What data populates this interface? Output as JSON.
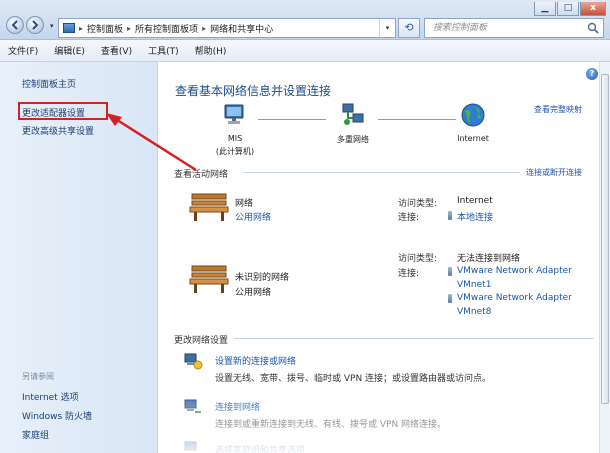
{
  "window": {
    "minimize": "▁",
    "maximize": "□",
    "close": "x"
  },
  "nav": {
    "back_icon": "back-arrow-icon",
    "forward_icon": "forward-arrow-icon",
    "history_icon": "chevron-down-icon"
  },
  "breadcrumb": [
    "控制面板",
    "所有控制面板项",
    "网络和共享中心"
  ],
  "search": {
    "placeholder": "搜索控制面板"
  },
  "menu": [
    "文件(F)",
    "编辑(E)",
    "查看(V)",
    "工具(T)",
    "帮助(H)"
  ],
  "sidebar": {
    "home": "控制面板主页",
    "items": [
      "更改适配器设置",
      "更改高级共享设置"
    ],
    "see_also_title": "另请参阅",
    "see_also": [
      "Internet 选项",
      "Windows 防火墙",
      "家庭组"
    ]
  },
  "main": {
    "title": "查看基本网络信息并设置连接",
    "view_full_map": "查看完整映射",
    "map_nodes": [
      {
        "label": "MIS",
        "sub": "(此计算机)",
        "icon": "computer-icon"
      },
      {
        "label": "多重网络",
        "sub": "",
        "icon": "multiple-networks-icon"
      },
      {
        "label": "Internet",
        "sub": "",
        "icon": "globe-icon"
      }
    ],
    "active_title": "查看活动网络",
    "connect_disconnect": "连接或断开连接",
    "networks": [
      {
        "name": "网络",
        "type": "公用网络",
        "access_label": "访问类型:",
        "access_value": "Internet",
        "conn_label": "连接:",
        "conn_values": [
          "本地连接"
        ]
      },
      {
        "name": "未识别的网络",
        "type": "公用网络",
        "access_label": "访问类型:",
        "access_value": "无法连接到网络",
        "conn_label": "连接:",
        "conn_values": [
          "VMware Network Adapter",
          "VMnet1",
          "VMware Network Adapter",
          "VMnet8"
        ]
      }
    ],
    "change_title": "更改网络设置",
    "tasks": [
      {
        "title": "设置新的连接或网络",
        "desc": "设置无线、宽带、拨号、临时或 VPN 连接；或设置路由器或访问点。"
      },
      {
        "title": "连接到网络",
        "desc": "连接到或重新连接到无线、有线、拨号或 VPN 网络连接。"
      },
      {
        "title": "选择家庭组和共享选项",
        "desc": ""
      }
    ]
  },
  "colors": {
    "link": "#1a56b0",
    "highlight_box": "#d92020",
    "arrow": "#d92020"
  }
}
